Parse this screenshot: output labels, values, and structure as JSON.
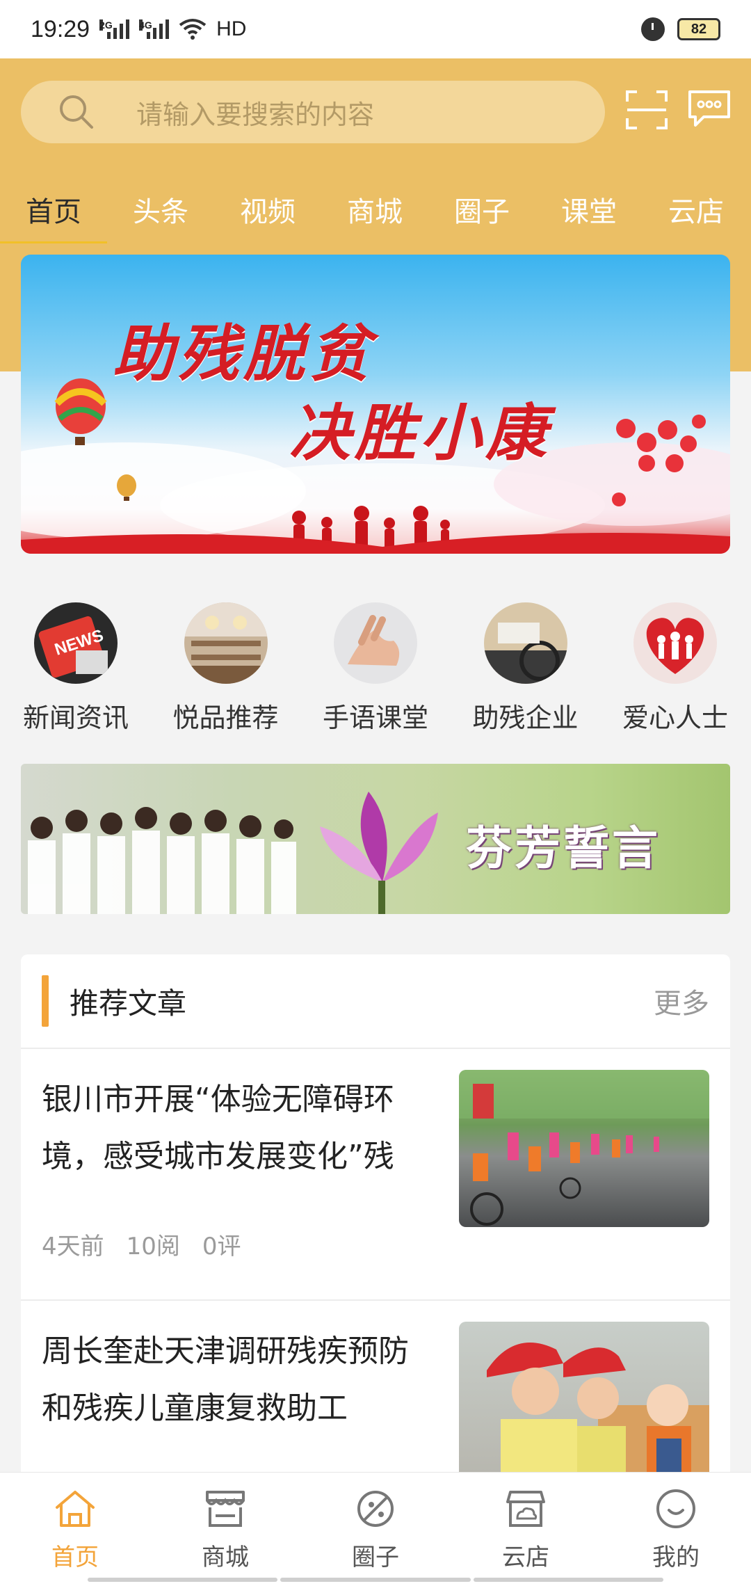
{
  "status_bar": {
    "time": "19:29",
    "sim1": "2G",
    "sim2": "4G",
    "hd": "HD",
    "battery": "82"
  },
  "search": {
    "placeholder": "请输入要搜索的内容"
  },
  "tabs": [
    {
      "label": "首页",
      "active": true
    },
    {
      "label": "头条",
      "active": false
    },
    {
      "label": "视频",
      "active": false
    },
    {
      "label": "商城",
      "active": false
    },
    {
      "label": "圈子",
      "active": false
    },
    {
      "label": "课堂",
      "active": false
    },
    {
      "label": "云店",
      "active": false
    }
  ],
  "hero": {
    "line1": "助残脱贫",
    "line2": "决胜小康"
  },
  "categories": [
    {
      "label": "新闻资讯",
      "icon": "news-icon"
    },
    {
      "label": "悦品推荐",
      "icon": "mall-icon"
    },
    {
      "label": "手语课堂",
      "icon": "sign-language-icon"
    },
    {
      "label": "助残企业",
      "icon": "enterprise-icon"
    },
    {
      "label": "爱心人士",
      "icon": "heart-people-icon"
    }
  ],
  "pledge": {
    "text": "芬芳誓言"
  },
  "recommend": {
    "title": "推荐文章",
    "more": "更多",
    "articles": [
      {
        "title": "银川市开展“体验无障碍环境，感受城市发展变化”残",
        "time": "4天前",
        "reads": "10阅",
        "comments": "0评"
      },
      {
        "title": "周长奎赴天津调研残疾预防和残疾儿童康复救助工",
        "time": "",
        "reads": "",
        "comments": ""
      }
    ]
  },
  "bottom_nav": [
    {
      "label": "首页",
      "icon": "home-icon",
      "active": true
    },
    {
      "label": "商城",
      "icon": "store-icon",
      "active": false
    },
    {
      "label": "圈子",
      "icon": "circle-icon",
      "active": false
    },
    {
      "label": "云店",
      "icon": "cloud-shop-icon",
      "active": false
    },
    {
      "label": "我的",
      "icon": "profile-icon",
      "active": false
    }
  ],
  "colors": {
    "header": "#ebbf65",
    "accent": "#f3a43a",
    "hero_text": "#d51d24"
  }
}
